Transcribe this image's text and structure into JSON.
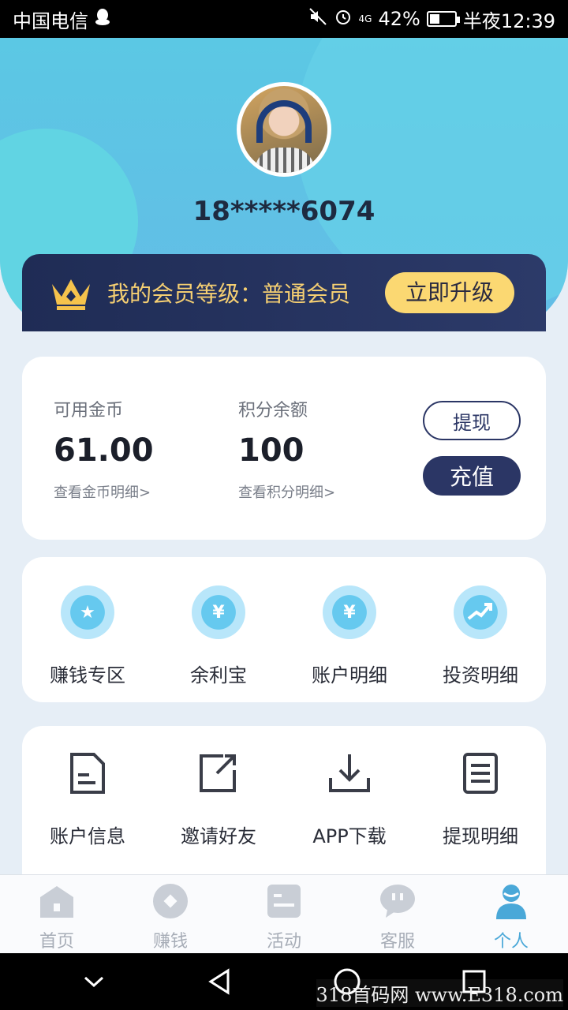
{
  "status_bar": {
    "carrier": "中国电信",
    "network": "4G",
    "battery": "42%",
    "battery_level": 0.42,
    "time": "半夜12:39"
  },
  "profile": {
    "phone_masked": "18*****6074"
  },
  "member": {
    "label": "我的会员等级：普通会员",
    "upgrade_label": "立即升级",
    "accent": "#f5cf72"
  },
  "balance": {
    "coins_label": "可用金币",
    "coins_value": "61.00",
    "coins_link": "查看金币明细>",
    "points_label": "积分余额",
    "points_value": "100",
    "points_link": "查看积分明细>",
    "withdraw_label": "提现",
    "recharge_label": "充值"
  },
  "grid1": [
    {
      "label": "赚钱专区",
      "icon": "ticket-star-icon"
    },
    {
      "label": "余利宝",
      "icon": "house-yen-icon"
    },
    {
      "label": "账户明细",
      "icon": "yen-doc-icon"
    },
    {
      "label": "投资明细",
      "icon": "chart-up-icon"
    }
  ],
  "grid2": [
    {
      "label": "账户信息",
      "icon": "document-icon"
    },
    {
      "label": "邀请好友",
      "icon": "share-icon"
    },
    {
      "label": "APP下载",
      "icon": "download-icon"
    },
    {
      "label": "提现明细",
      "icon": "list-doc-icon"
    }
  ],
  "tabs": [
    {
      "label": "首页",
      "icon": "home-icon"
    },
    {
      "label": "赚钱",
      "icon": "coin-icon"
    },
    {
      "label": "活动",
      "icon": "activity-icon"
    },
    {
      "label": "客服",
      "icon": "chat-icon"
    },
    {
      "label": "个人",
      "icon": "person-icon",
      "active": true
    }
  ],
  "watermark": "318首码网 www.E318.com"
}
